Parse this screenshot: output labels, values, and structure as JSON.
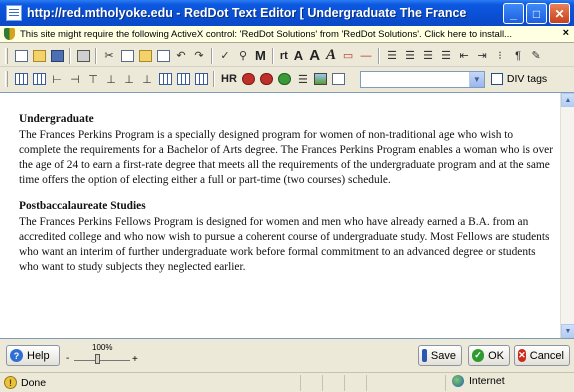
{
  "window": {
    "title": "http://red.mtholyoke.edu - RedDot Text Editor [ Undergraduate The Frances Perkins Prog...",
    "buttons": {
      "minimize": "_",
      "maximize": "□",
      "close": "✕"
    }
  },
  "infobar": {
    "text": "This site might require the following ActiveX control: 'RedDot Solutions' from 'RedDot Solutions'. Click here to install...",
    "close": "×"
  },
  "toolbar": {
    "text_buttons": {
      "macro": "M",
      "style_rt": "rt",
      "font_a_small": "A",
      "font_a_large": "A",
      "font_a_italic": "A",
      "hr": "HR"
    },
    "style_select_value": "",
    "divtags_label": "DIV tags"
  },
  "document": {
    "sections": [
      {
        "heading": "Undergraduate",
        "body": "The Frances Perkins Program is a specially designed program for women of non-traditional age who wish to complete the requirements for a Bachelor of Arts degree. The Frances Perkins Program enables a woman who is over the age of 24 to earn a first-rate degree that meets all the requirements of the undergraduate program and at the same time offers the option of electing either a full or part-time (two courses) schedule."
      },
      {
        "heading": "Postbaccalaureate Studies",
        "body": "The Frances Perkins Fellows Program is designed for women and men who have already earned a B.A. from an accredited college and who now wish to pursue a coherent course of undergraduate study. Most Fellows are students who want an interim of further undergraduate work before formal commitment to an advanced degree or students who want to study subjects they neglected earlier."
      }
    ]
  },
  "bottombar": {
    "help_label": "Help",
    "zoom_label": "100%",
    "zoom_minus": "-",
    "zoom_plus": "+",
    "save_label": "Save",
    "ok_label": "OK",
    "cancel_label": "Cancel"
  },
  "statusbar": {
    "status_text": "Done",
    "zone_text": "Internet"
  },
  "colors": {
    "titlebar": "#0a4fd4",
    "infobar": "#ffffe1",
    "chrome": "#ece9d8"
  }
}
